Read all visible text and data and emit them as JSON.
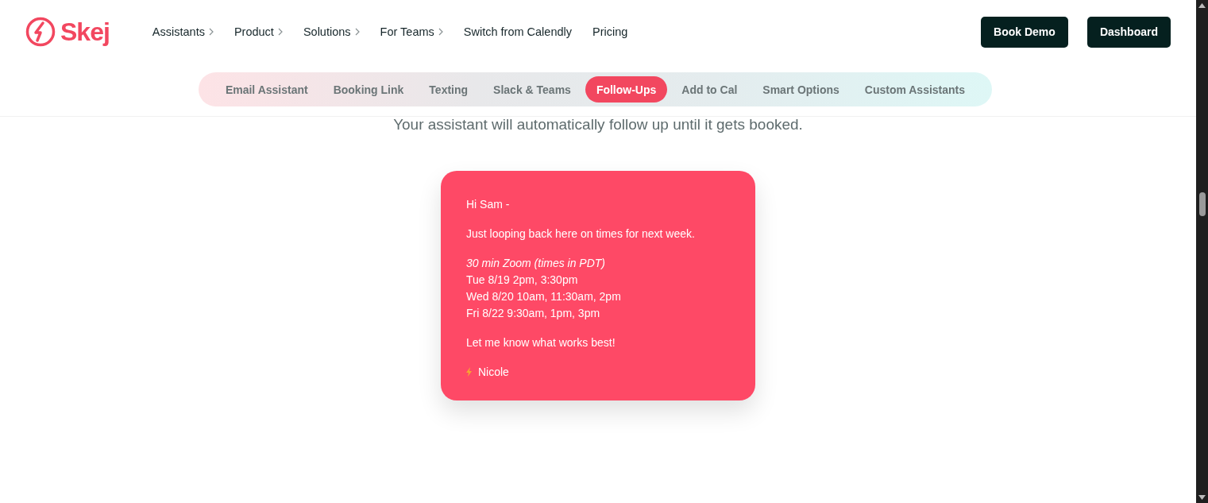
{
  "logo": {
    "text": "Skej"
  },
  "nav": [
    {
      "label": "Assistants",
      "has_submenu": true
    },
    {
      "label": "Product",
      "has_submenu": true
    },
    {
      "label": "Solutions",
      "has_submenu": true
    },
    {
      "label": "For Teams",
      "has_submenu": true
    },
    {
      "label": "Switch from Calendly",
      "has_submenu": false
    },
    {
      "label": "Pricing",
      "has_submenu": false
    }
  ],
  "header_buttons": [
    "Book Demo",
    "Dashboard"
  ],
  "tabs": [
    {
      "label": "Email Assistant",
      "selected": false
    },
    {
      "label": "Booking Link",
      "selected": false
    },
    {
      "label": "Texting",
      "selected": false
    },
    {
      "label": "Slack & Teams",
      "selected": false
    },
    {
      "label": "Follow-Ups",
      "selected": true
    },
    {
      "label": "Add to Cal",
      "selected": false
    },
    {
      "label": "Smart Options",
      "selected": false
    },
    {
      "label": "Custom Assistants",
      "selected": false
    }
  ],
  "subtitle": "Your assistant will automatically follow up until it gets booked.",
  "email": {
    "paragraphs": [
      [
        {
          "text": "Hi Sam -",
          "kind": "plain"
        }
      ],
      [
        {
          "text": "Just looping back here on times for next week.",
          "kind": "plain"
        }
      ],
      [
        {
          "text": "30 min Zoom (times in PDT)",
          "kind": "italic"
        },
        {
          "text": "Tue 8/19 2pm, 3:30pm",
          "kind": "plain"
        },
        {
          "text": "Wed 8/20 10am, 11:30am, 2pm",
          "kind": "plain"
        },
        {
          "text": "Fri 8/22 9:30am, 1pm, 3pm",
          "kind": "plain"
        }
      ],
      [
        {
          "text": "Let me know what works best!",
          "kind": "plain"
        }
      ]
    ],
    "signature": "Nicole"
  }
}
